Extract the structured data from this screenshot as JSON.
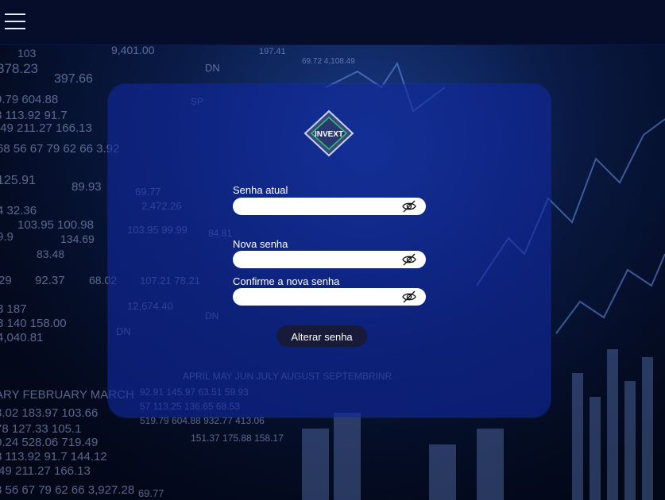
{
  "header": {
    "menu_icon": "hamburger-menu-icon"
  },
  "logo": {
    "text": "INVEXT"
  },
  "form": {
    "current_password": {
      "label": "Senha atual",
      "value": "",
      "icon": "eye-off-icon"
    },
    "new_password": {
      "label": "Nova senha",
      "value": "",
      "icon": "eye-off-icon"
    },
    "confirm_password": {
      "label": "Confirme a nova senha",
      "value": "",
      "icon": "eye-off-icon"
    },
    "submit_label": "Alterar senha"
  },
  "colors": {
    "topbar": "#060d2b",
    "card": "#1028a0",
    "button": "#171a38",
    "logo_accent": "#2ecc71"
  }
}
